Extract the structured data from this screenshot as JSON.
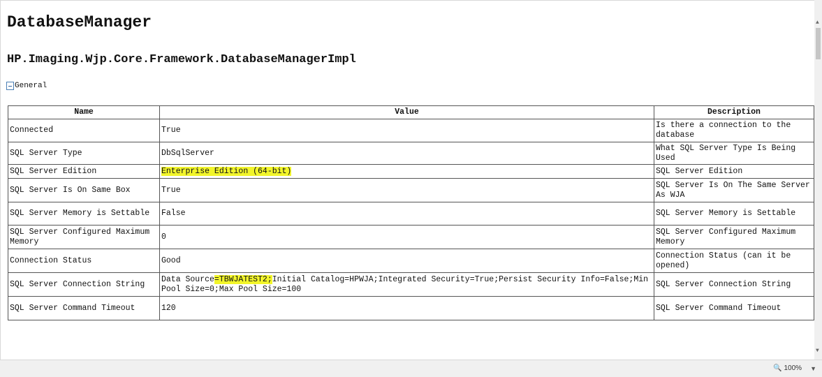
{
  "page": {
    "title": "DatabaseManager",
    "subtitle": "HP.Imaging.Wjp.Core.Framework.DatabaseManagerImpl",
    "section_label": "General"
  },
  "table": {
    "headers": [
      "Name",
      "Value",
      "Description"
    ],
    "rows": [
      {
        "name": "Connected",
        "value": "True",
        "description": "Is there a connection to the database"
      },
      {
        "name": "SQL Server Type",
        "value": "DbSqlServer",
        "description": "What SQL Server Type Is Being Used"
      },
      {
        "name": "SQL Server Edition",
        "value": "Enterprise Edition (64-bit)",
        "description": "SQL Server Edition"
      },
      {
        "name": "SQL Server Is On Same Box",
        "value": "True",
        "description": "SQL Server Is On The Same Server As WJA"
      },
      {
        "name": "SQL Server Memory is Settable",
        "value": "False",
        "description": "SQL Server Memory is Settable"
      },
      {
        "name": "SQL Server Configured Maximum Memory",
        "value": "0",
        "description": "SQL Server Configured Maximum Memory"
      },
      {
        "name": "Connection Status",
        "value": "Good",
        "description": "Connection Status (can it be opened)"
      },
      {
        "name": "SQL Server Connection String",
        "value_prefix": "Data Source",
        "value_highlight": "=TBWJATEST2;",
        "value_suffix": "Initial Catalog=HPWJA;Integrated Security=True;Persist Security Info=False;Min Pool Size=0;Max Pool Size=100",
        "description": "SQL Server Connection String"
      },
      {
        "name": "SQL Server Command Timeout",
        "value": "120",
        "description": "SQL Server Command Timeout"
      }
    ]
  },
  "status": {
    "zoom": "100%",
    "zoom_icon": "magnifier-icon"
  },
  "colors": {
    "highlight": "#f2f52a",
    "table_border": "#555555",
    "toggle_border": "#4a7fb5"
  }
}
